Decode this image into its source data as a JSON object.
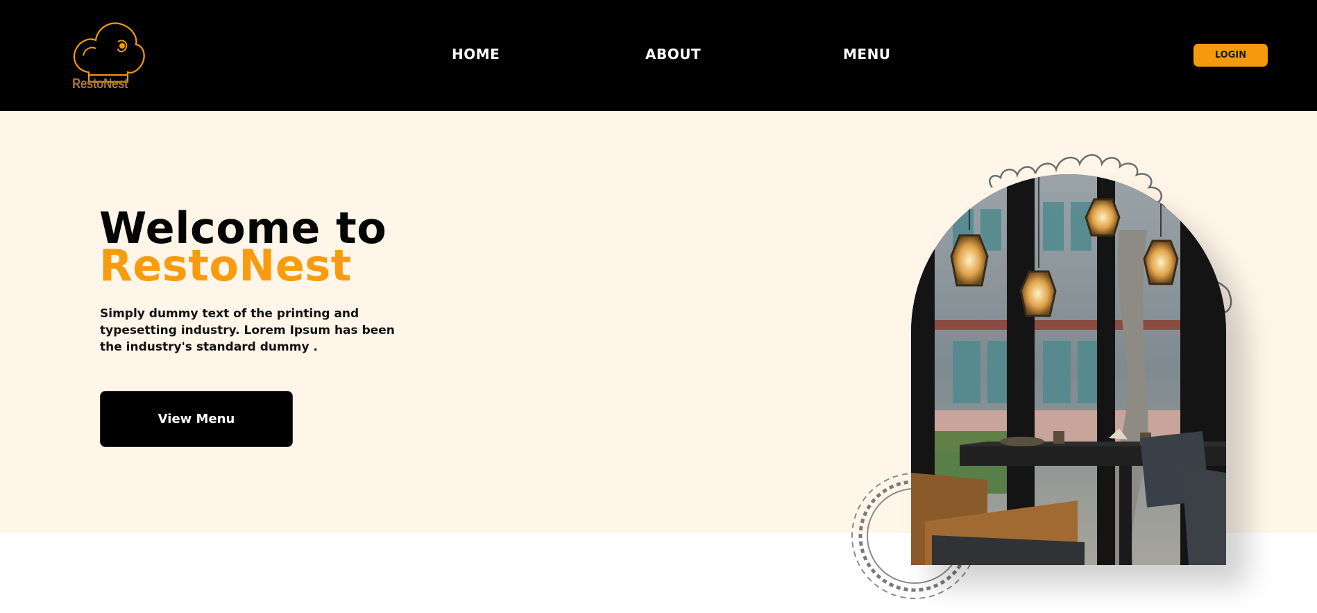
{
  "navbar": {
    "brand": "RestoNest",
    "links": [
      {
        "label": "HOME"
      },
      {
        "label": "ABOUT"
      },
      {
        "label": "MENU"
      }
    ],
    "login_label": "LOGIN"
  },
  "hero": {
    "title_line1": "Welcome to",
    "title_line2": "RestoNest",
    "description": "Simply dummy text of the printing and typesetting industry. Lorem Ipsum has been the industry's standard dummy .",
    "button_label": "View Menu"
  },
  "colors": {
    "accent": "#f89c0e",
    "navbar_bg": "#000000",
    "hero_bg": "#fff5e9",
    "logo_text": "#a8743a"
  },
  "icons": {
    "logo": "chef-hat-icon",
    "decoration_top": "wavy-circle-decoration",
    "decoration_bottom": "gear-circle-decoration"
  }
}
